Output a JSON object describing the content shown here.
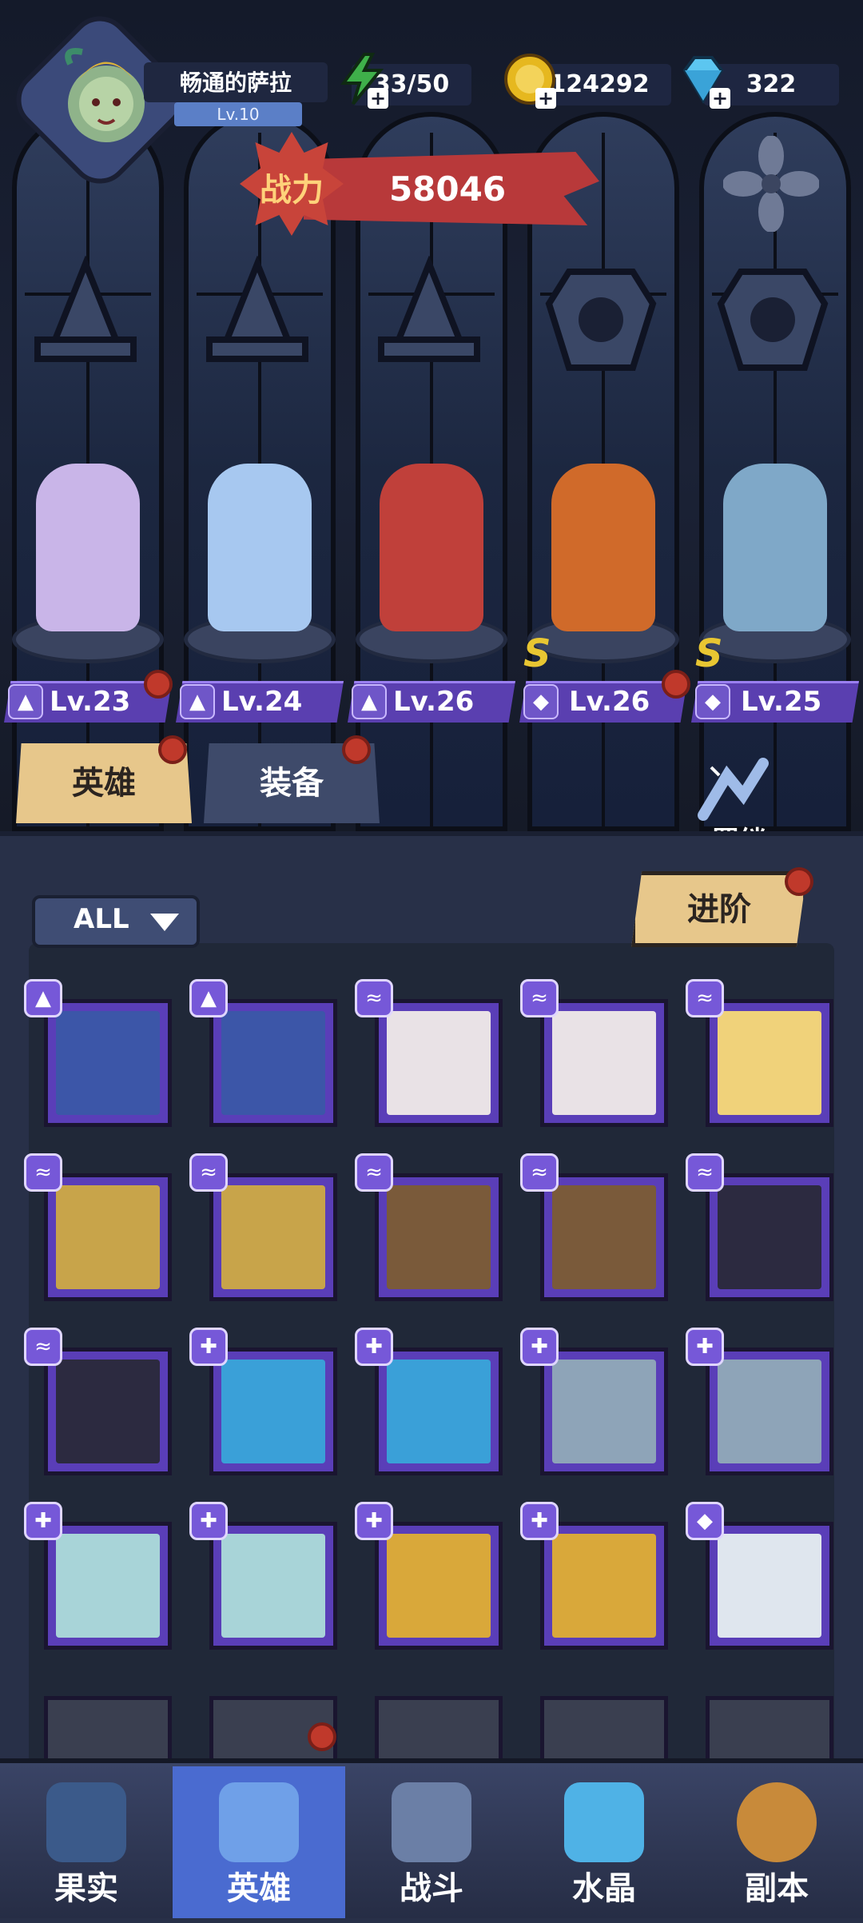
{
  "player": {
    "name": "畅通的萨拉",
    "level": "Lv.10"
  },
  "resources": {
    "stamina": "33/50",
    "gold": "124292",
    "gems": "322"
  },
  "power": {
    "label": "战力",
    "value": "58046"
  },
  "heroes": [
    {
      "level": "Lv.23",
      "class_icon": "mage-hat-icon",
      "rank": "",
      "color": "#c9b5e8"
    },
    {
      "level": "Lv.24",
      "class_icon": "mage-hat-icon",
      "rank": "",
      "color": "#a7c8f0"
    },
    {
      "level": "Lv.26",
      "class_icon": "mage-hat-icon",
      "rank": "",
      "color": "#c0403a"
    },
    {
      "level": "Lv.26",
      "class_icon": "beast-claw-icon",
      "rank": "S",
      "color": "#d06a2a"
    },
    {
      "level": "Lv.25",
      "class_icon": "beast-claw-icon",
      "rank": "S",
      "color": "#7fa8c8"
    }
  ],
  "tabs": {
    "heroes": "英雄",
    "equipment": "装备"
  },
  "bond": {
    "label": "羁绊"
  },
  "filter": {
    "label": "ALL"
  },
  "advance": {
    "label": "进阶"
  },
  "nav": [
    {
      "label": "果实",
      "icon": "fruit-icon"
    },
    {
      "label": "英雄",
      "icon": "hero-icon"
    },
    {
      "label": "战斗",
      "icon": "battle-icon"
    },
    {
      "label": "水晶",
      "icon": "crystal-icon"
    },
    {
      "label": "副本",
      "icon": "dungeon-icon"
    }
  ],
  "colors": {
    "accent_purple": "#5a3eb8",
    "gold_tab": "#e7c78b",
    "red_banner": "#b8393a",
    "notification": "#c0392b"
  }
}
